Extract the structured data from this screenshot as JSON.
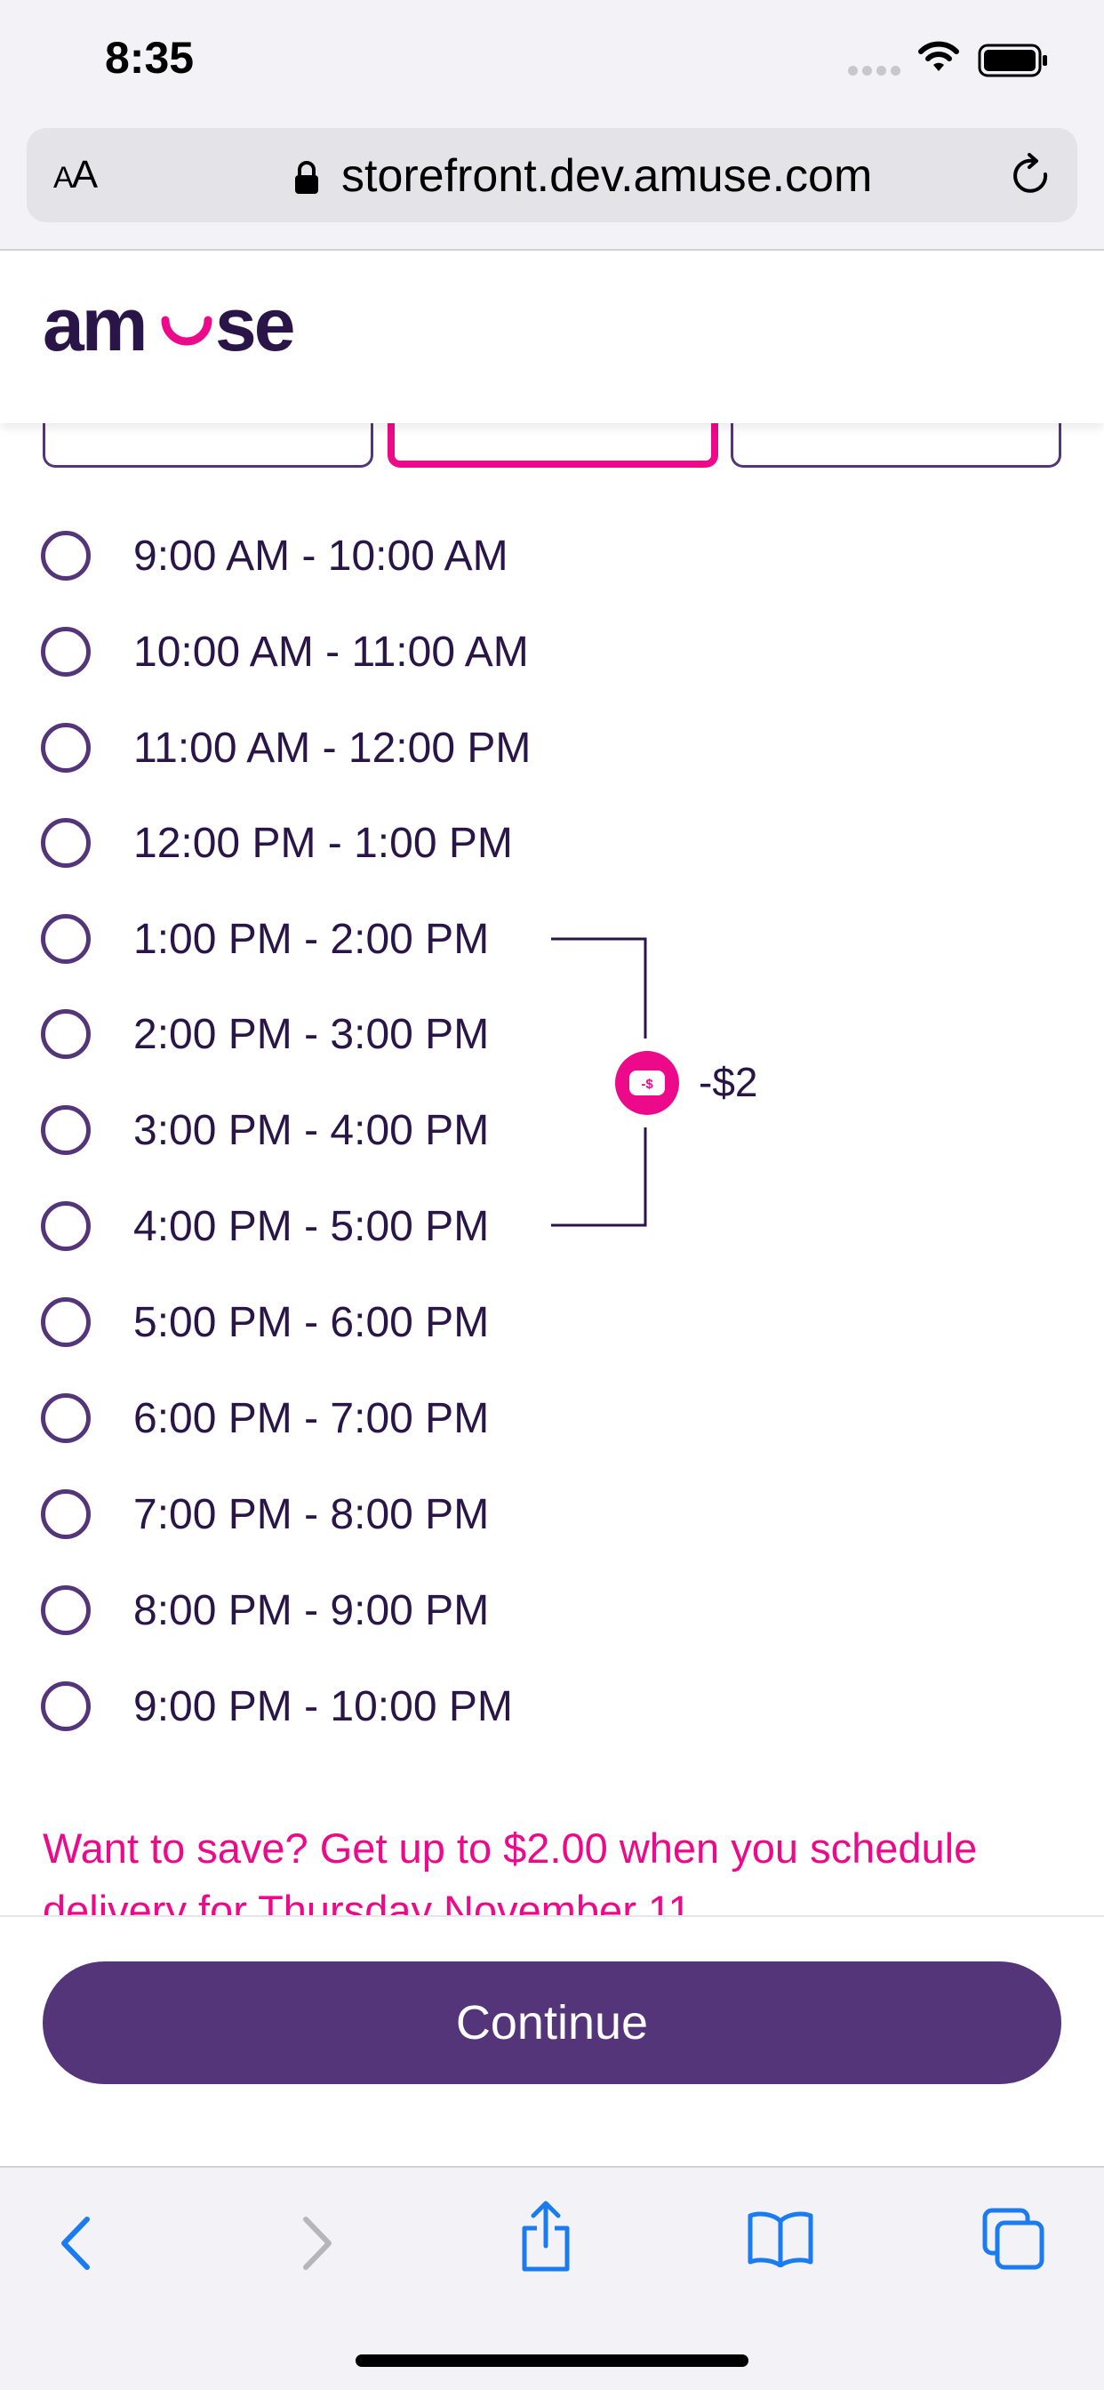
{
  "status_bar": {
    "time": "8:35"
  },
  "browser": {
    "aa_label_small": "A",
    "aa_label_large": "A",
    "url": "storefront.dev.amuse.com"
  },
  "header": {
    "logo_text": "amuse"
  },
  "time_slots": [
    {
      "label": "9:00 AM - 10:00 AM"
    },
    {
      "label": "10:00 AM - 11:00 AM"
    },
    {
      "label": "11:00 AM - 12:00 PM"
    },
    {
      "label": "12:00 PM - 1:00 PM"
    },
    {
      "label": "1:00 PM - 2:00 PM"
    },
    {
      "label": "2:00 PM - 3:00 PM"
    },
    {
      "label": "3:00 PM - 4:00 PM"
    },
    {
      "label": "4:00 PM - 5:00 PM"
    },
    {
      "label": "5:00 PM - 6:00 PM"
    },
    {
      "label": "6:00 PM - 7:00 PM"
    },
    {
      "label": "7:00 PM - 8:00 PM"
    },
    {
      "label": "8:00 PM - 9:00 PM"
    },
    {
      "label": "9:00 PM - 10:00 PM"
    }
  ],
  "discount": {
    "badge_text": "-$",
    "amount": "-$2"
  },
  "promo_text": "Want to save? Get up to $2.00 when you schedule delivery for Thursday November 11",
  "continue_label": "Continue",
  "colors": {
    "brand_purple": "#55357a",
    "accent_pink": "#ec0a8a",
    "text_dark": "#2a1548",
    "ios_blue": "#1a7cf0"
  }
}
